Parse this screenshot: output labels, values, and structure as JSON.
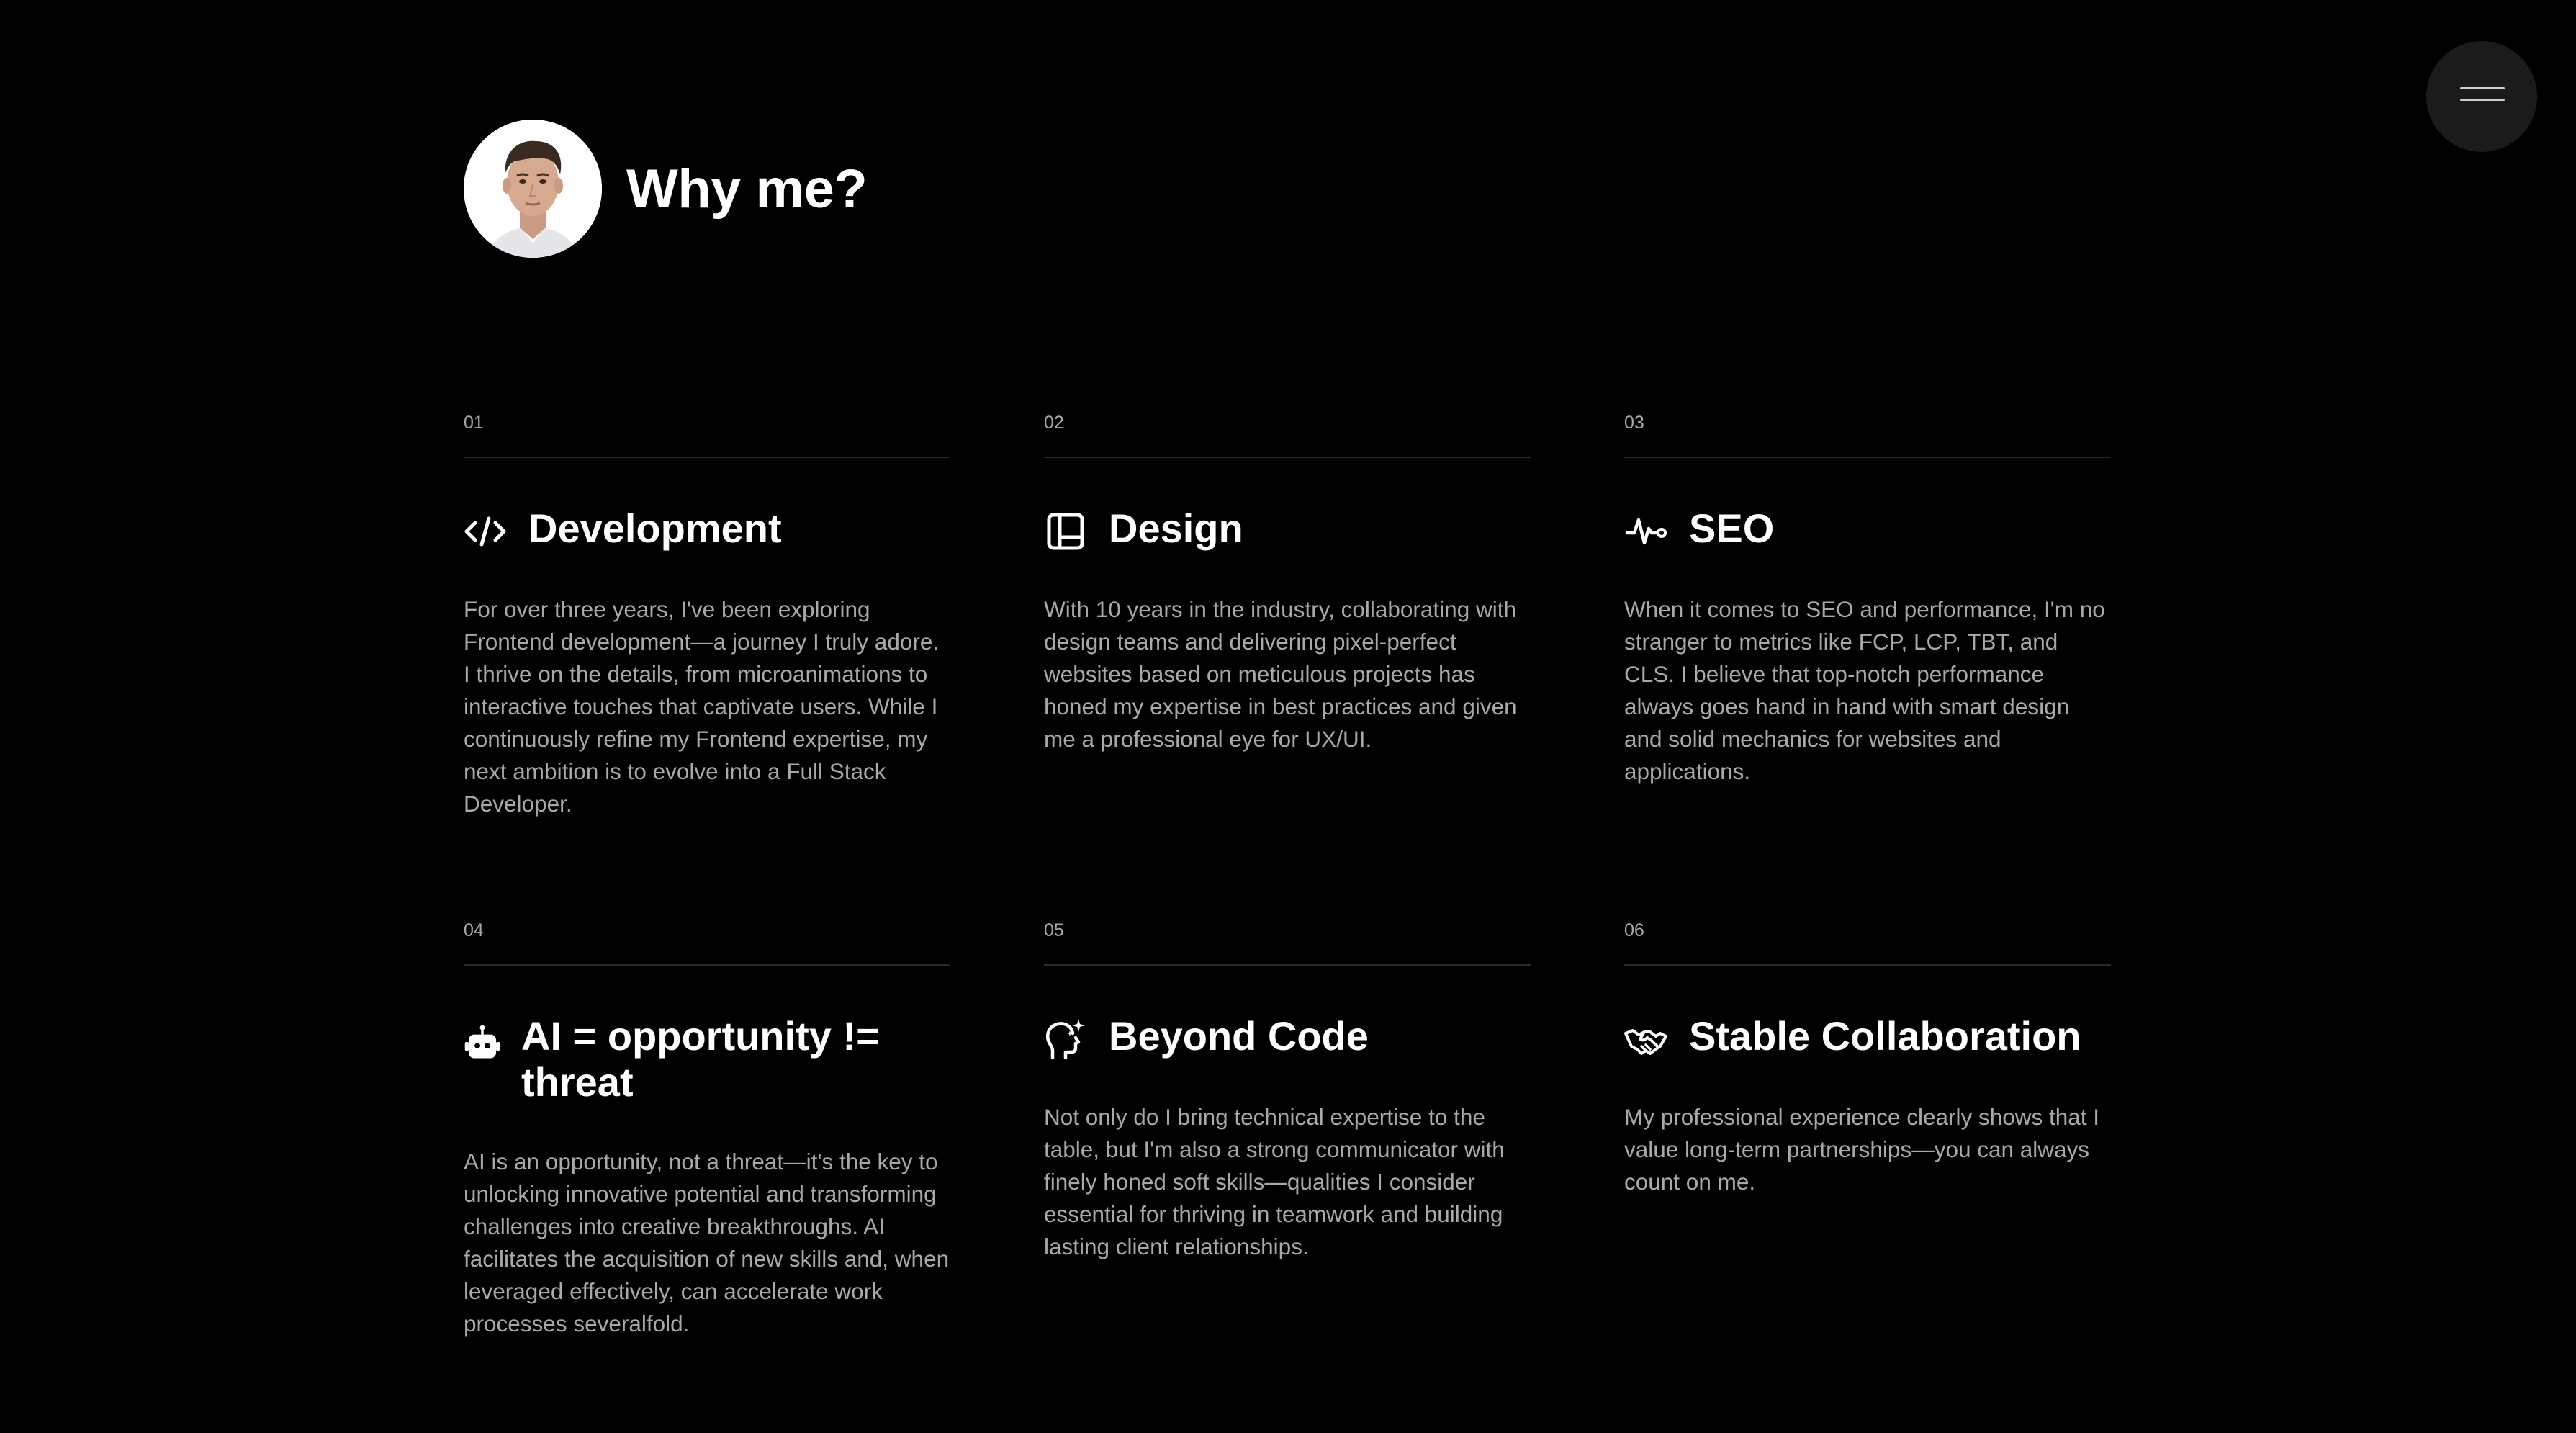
{
  "header": {
    "title": "Why me?",
    "avatar_icon": "portrait-avatar"
  },
  "menu": {
    "icon": "hamburger-menu-icon"
  },
  "colors": {
    "background": "#000000",
    "text_primary": "#ffffff",
    "text_secondary": "#a9a9a9",
    "divider": "#2a2a2a",
    "menu_button": "#1b1b1b"
  },
  "cards": [
    {
      "number": "01",
      "icon": "code-icon",
      "title": "Development",
      "text": "For over three years, I've been exploring Frontend development—a journey I truly adore. I thrive on the details, from microanimations to interactive touches that captivate users. While I continuously refine my Frontend expertise, my next ambition is to evolve into a Full Stack Developer."
    },
    {
      "number": "02",
      "icon": "layout-icon",
      "title": "Design",
      "text": "With 10 years in the industry, collaborating with design teams and delivering pixel-perfect websites based on meticulous projects has honed my expertise in best practices and given me a professional eye for UX/UI."
    },
    {
      "number": "03",
      "icon": "pulse-icon",
      "title": "SEO",
      "text": "When it comes to SEO and performance, I'm no stranger to metrics like FCP, LCP, TBT, and CLS. I believe that top-notch performance always goes hand in hand with smart design and solid mechanics for websites and applications."
    },
    {
      "number": "04",
      "icon": "robot-icon",
      "title": "AI = opportunity != threat",
      "text": "AI is an opportunity, not a threat—it's the key to unlocking innovative potential and transforming challenges into creative breakthroughs. AI facilitates the acquisition of new skills and, when leveraged effectively, can accelerate work processes severalfold."
    },
    {
      "number": "05",
      "icon": "head-sparkle-icon",
      "title": "Beyond Code",
      "text": "Not only do I bring technical expertise to the table, but I'm also a strong communicator with finely honed soft skills—qualities I consider essential for thriving in teamwork and building lasting client relationships."
    },
    {
      "number": "06",
      "icon": "handshake-icon",
      "title": "Stable Collaboration",
      "text": "My professional experience clearly shows that I value long-term partnerships—you can always count on me."
    }
  ]
}
